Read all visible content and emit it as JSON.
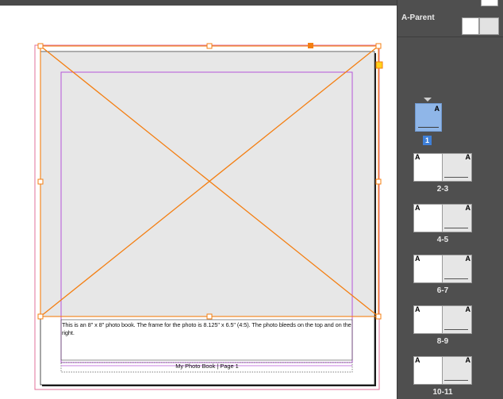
{
  "document": {
    "caption": "This is an 8\" x 8\" photo book. The frame for the photo is 8.125\" x 6.5\" (4:5). The photo bleeds on the top and on the right.",
    "footer": "My Photo Book | Page 1"
  },
  "colors": {
    "selection": "#f47f12",
    "margin_guide": "#b556d8",
    "bleed_guide": "#e0709a",
    "frame_fill": "#e7e7e7",
    "panel_bg": "#4f4f4f",
    "page_selected": "#8fb6e8",
    "page_number_bg": "#3f80d8"
  },
  "pages_panel": {
    "parent_label": "A-Parent",
    "first_page": {
      "parent_marker": "A",
      "number": "1"
    },
    "spreads": [
      {
        "label": "2-3",
        "left_marker": "A",
        "right_marker": "A"
      },
      {
        "label": "4-5",
        "left_marker": "A",
        "right_marker": "A"
      },
      {
        "label": "6-7",
        "left_marker": "A",
        "right_marker": "A"
      },
      {
        "label": "8-9",
        "left_marker": "A",
        "right_marker": "A"
      },
      {
        "label": "10-11",
        "left_marker": "A",
        "right_marker": "A"
      }
    ]
  }
}
